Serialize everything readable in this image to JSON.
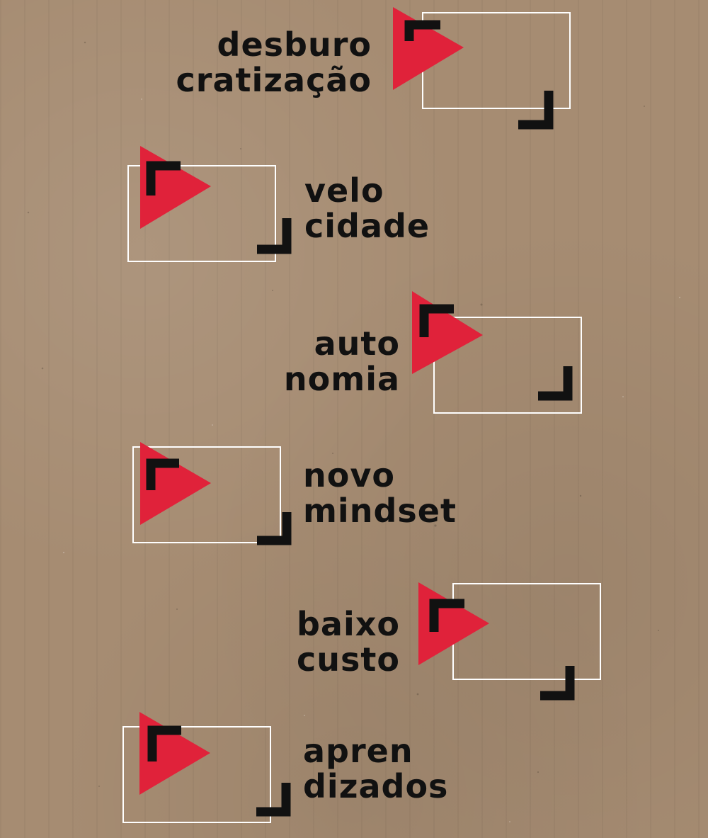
{
  "colors": {
    "background": "#a68c72",
    "triangle": "#e0223a",
    "corner": "#111111",
    "frame": "#ffffff",
    "text": "#111111"
  },
  "items": [
    {
      "line1": "desburo",
      "line2": "cratização",
      "icon": "play-frame-icon"
    },
    {
      "line1": "velo",
      "line2": "cidade",
      "icon": "play-frame-icon"
    },
    {
      "line1": "auto",
      "line2": "nomia",
      "icon": "play-frame-icon"
    },
    {
      "line1": "novo",
      "line2": "mindset",
      "icon": "play-frame-icon"
    },
    {
      "line1": "baixo",
      "line2": "custo",
      "icon": "play-frame-icon"
    },
    {
      "line1": "apren",
      "line2": "dizados",
      "icon": "play-frame-icon"
    }
  ]
}
